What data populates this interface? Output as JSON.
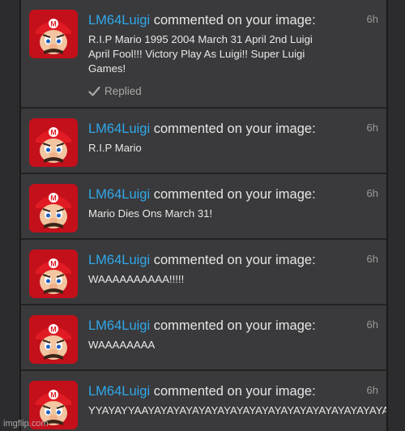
{
  "notifications": [
    {
      "username": "LM64Luigi",
      "action": " commented on your image:",
      "time": "6h",
      "message": "R.I.P Mario 1995 2004 March 31 April 2nd Luigi\nApril Fool!!! Victory Play As Luigi!! Super Luigi\nGames!",
      "replied_label": "Replied",
      "avatar_icon": "sad-mario-avatar-icon"
    },
    {
      "username": "LM64Luigi",
      "action": " commented on your image:",
      "time": "6h",
      "message": "R.I.P Mario",
      "avatar_icon": "sad-mario-avatar-icon"
    },
    {
      "username": "LM64Luigi",
      "action": " commented on your image:",
      "time": "6h",
      "message": "Mario Dies Ons March 31!",
      "avatar_icon": "sad-mario-avatar-icon"
    },
    {
      "username": "LM64Luigi",
      "action": " commented on your image:",
      "time": "6h",
      "message": "WAAAAAAAAAA!!!!!",
      "avatar_icon": "sad-mario-avatar-icon"
    },
    {
      "username": "LM64Luigi",
      "action": " commented on your image:",
      "time": "6h",
      "message": "WAAAAAAAA",
      "avatar_icon": "sad-mario-avatar-icon"
    },
    {
      "username": "LM64Luigi",
      "action": " commented on your image:",
      "time": "6h",
      "message": "YYAYAYYAAYAYAYAYAYAYAYAYAYAYAYAYAYAYAYAYAYAYAYAYA",
      "avatar_icon": "sad-mario-avatar-icon"
    }
  ],
  "watermark": "imgflip.com",
  "colors": {
    "background": "#2c2c2e",
    "panel": "#3a3a3c",
    "username": "#2fa8ea",
    "text": "#e6e6e6",
    "muted": "#9a9a9a"
  }
}
